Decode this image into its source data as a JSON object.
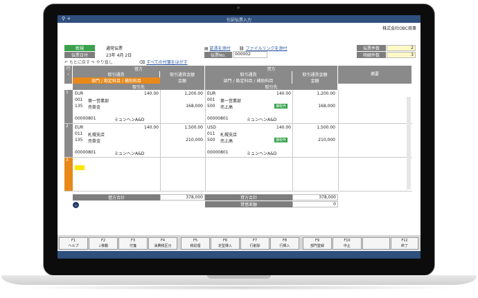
{
  "window": {
    "title": "仕訳伝票入力",
    "title_icon": "search-icon"
  },
  "company": "株式会社OBC商事",
  "header": {
    "status_badge": "新規",
    "slip_type": "通常伝票",
    "date_label": "伝票日付",
    "date_year": "23年",
    "date_month": "4月",
    "date_day": "2日",
    "attach_label": "証憑を添付",
    "file_link_label": "ファイルリンクを添付",
    "slip_no_label": "伝票No.",
    "slip_no_value": "000002",
    "undo": "もとに戻す",
    "redo": "やり直し",
    "remove_tags": "すべての付箋をはがす",
    "slip_count_label": "伝票件数",
    "slip_count_value": "2",
    "detail_count_label": "明細件数",
    "detail_count_value": "3"
  },
  "columns": {
    "row": "行",
    "debit": "借方",
    "credit": "貸方",
    "currency": "取引通貨",
    "currency_amount": "取引通貨金額",
    "dept_account": "部門 / 勘定科目 / 補助科目",
    "amount": "金額",
    "partner": "取引先",
    "memo": "摘要"
  },
  "rows": [
    {
      "num": "1",
      "debit": {
        "currency": "EUR",
        "rate": "140.00",
        "fx_amount": "1,200.00",
        "dept_code": "001",
        "dept": "第一営業部",
        "acct_code": "135",
        "acct": "売掛金",
        "amount": "168,000",
        "partner_code": "00000801",
        "partner": "ミュンヘンA&D"
      },
      "credit": {
        "currency": "EUR",
        "rate": "140.00",
        "fx_amount": "1,200.00",
        "dept_code": "001",
        "dept": "第一営業部",
        "acct_code": "500",
        "acct": "売上高",
        "tax": "課税売",
        "amount": "168,000",
        "partner_code": "00000801",
        "partner": "ミュンヘンA&D"
      }
    },
    {
      "num": "2",
      "debit": {
        "currency": "EUR",
        "rate": "140.00",
        "fx_amount": "1,500.00",
        "dept_code": "011",
        "dept": "札幌支店",
        "acct_code": "135",
        "acct": "売掛金",
        "amount": "210,000",
        "partner_code": "00000801",
        "partner": "ミュンヘンA&D"
      },
      "credit": {
        "currency": "USD",
        "rate": "140.00",
        "fx_amount": "1,500.00",
        "dept_code": "011",
        "dept": "札幌支店",
        "acct_code": "500",
        "acct": "売上高",
        "tax": "課税売",
        "amount": "210,000",
        "partner_code": "00000801",
        "partner": "ミュンヘンA&D"
      }
    },
    {
      "num": "3"
    }
  ],
  "totals": {
    "debit_label": "借方合計",
    "debit_value": "378,000",
    "credit_label": "貸方合計",
    "credit_value": "378,000",
    "diff_label": "貸借差額",
    "diff_value": "0"
  },
  "fkeys": [
    {
      "key": "F1",
      "label": "ヘルプ"
    },
    {
      "key": "F2",
      "label": "↓移動"
    },
    {
      "key": "F3",
      "label": "付箋"
    },
    {
      "key": "F4",
      "label": "消費税区分"
    },
    {
      "key": "F5",
      "label": "税処理"
    },
    {
      "key": "F6",
      "label": "定型挿入"
    },
    {
      "key": "F7",
      "label": "行削除"
    },
    {
      "key": "F8",
      "label": "行挿入"
    },
    {
      "key": "F9",
      "label": "部門登録"
    },
    {
      "key": "F10",
      "label": "中止"
    },
    {
      "key": "",
      "label": ""
    },
    {
      "key": "F12",
      "label": "終了"
    }
  ],
  "colors": {
    "titlebar": "#2f4f7d",
    "accent_green": "#3aa24c",
    "accent_orange": "#e8891a",
    "header_gray": "#8a8a8a"
  }
}
